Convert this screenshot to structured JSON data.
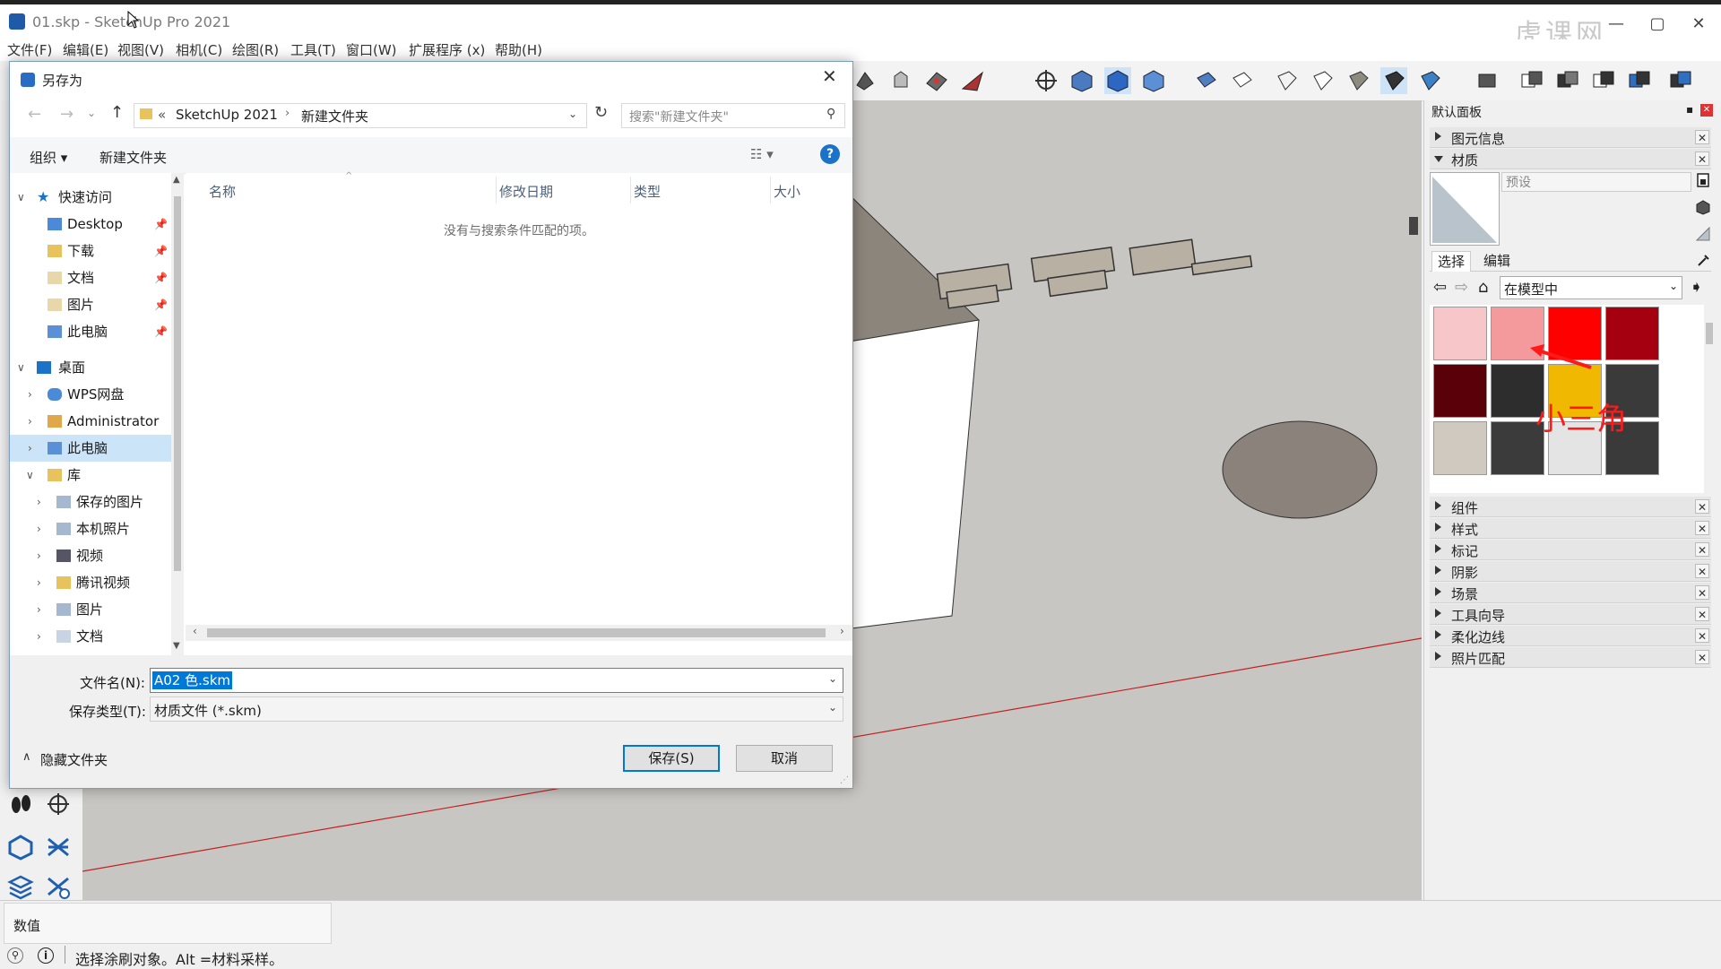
{
  "window": {
    "title": "01.skp - SketchUp Pro 2021",
    "watermark": "虎课网"
  },
  "menu": [
    "文件(F)",
    "编辑(E)",
    "视图(V)",
    "相机(C)",
    "绘图(R)",
    "工具(T)",
    "窗口(W)",
    "扩展程序 (x)",
    "帮助(H)"
  ],
  "dialog": {
    "title": "另存为",
    "breadcrumb_prefix": "«",
    "breadcrumb": [
      "SketchUp 2021",
      "新建文件夹"
    ],
    "search_placeholder": "搜索\"新建文件夹\"",
    "organize": "组织 ▾",
    "new_folder": "新建文件夹",
    "help": "?",
    "nav": {
      "quick_access": "快速访问",
      "items": [
        "Desktop",
        "下载",
        "文档",
        "图片",
        "此电脑"
      ],
      "desktop": "桌面",
      "desktop_items": [
        "WPS网盘",
        "Administrator",
        "此电脑"
      ],
      "library": "库",
      "library_items": [
        "保存的图片",
        "本机照片",
        "视频",
        "腾讯视频",
        "图片",
        "文档"
      ]
    },
    "columns": [
      "名称",
      "修改日期",
      "类型",
      "大小"
    ],
    "empty_message": "没有与搜索条件匹配的项。",
    "filename_label": "文件名(N):",
    "filename_value": "A02 色.skm",
    "filetype_label": "保存类型(T):",
    "filetype_value": "材质文件 (*.skm)",
    "hide_folders": "隐藏文件夹",
    "save": "保存(S)",
    "cancel": "取消"
  },
  "tray": {
    "title": "默认面板",
    "entity_info": "图元信息",
    "materials": "材质",
    "preset": "预设",
    "tab_select": "选择",
    "tab_edit": "编辑",
    "in_model": "在模型中",
    "annotation": "小三角",
    "swatch_colors": [
      "#f7c6c8",
      "#f59a9c",
      "#ff0000",
      "#a50010",
      "#5a0008",
      "#2d2d2d",
      "#f0b800",
      "#3a3a3a",
      "#cfc9c0",
      "#3b3b3b",
      "#e4e4e4",
      "#3a3a3a"
    ],
    "sections": [
      "组件",
      "样式",
      "标记",
      "阴影",
      "场景",
      "工具向导",
      "柔化边线",
      "照片匹配"
    ]
  },
  "statusbar": {
    "measurements_label": "数值",
    "message": "选择涂刷对象。Alt =材料采样。"
  },
  "colors": {
    "accent": "#0078d7",
    "annotation_red": "#ff1a1a",
    "axis_red": "#c42020"
  }
}
